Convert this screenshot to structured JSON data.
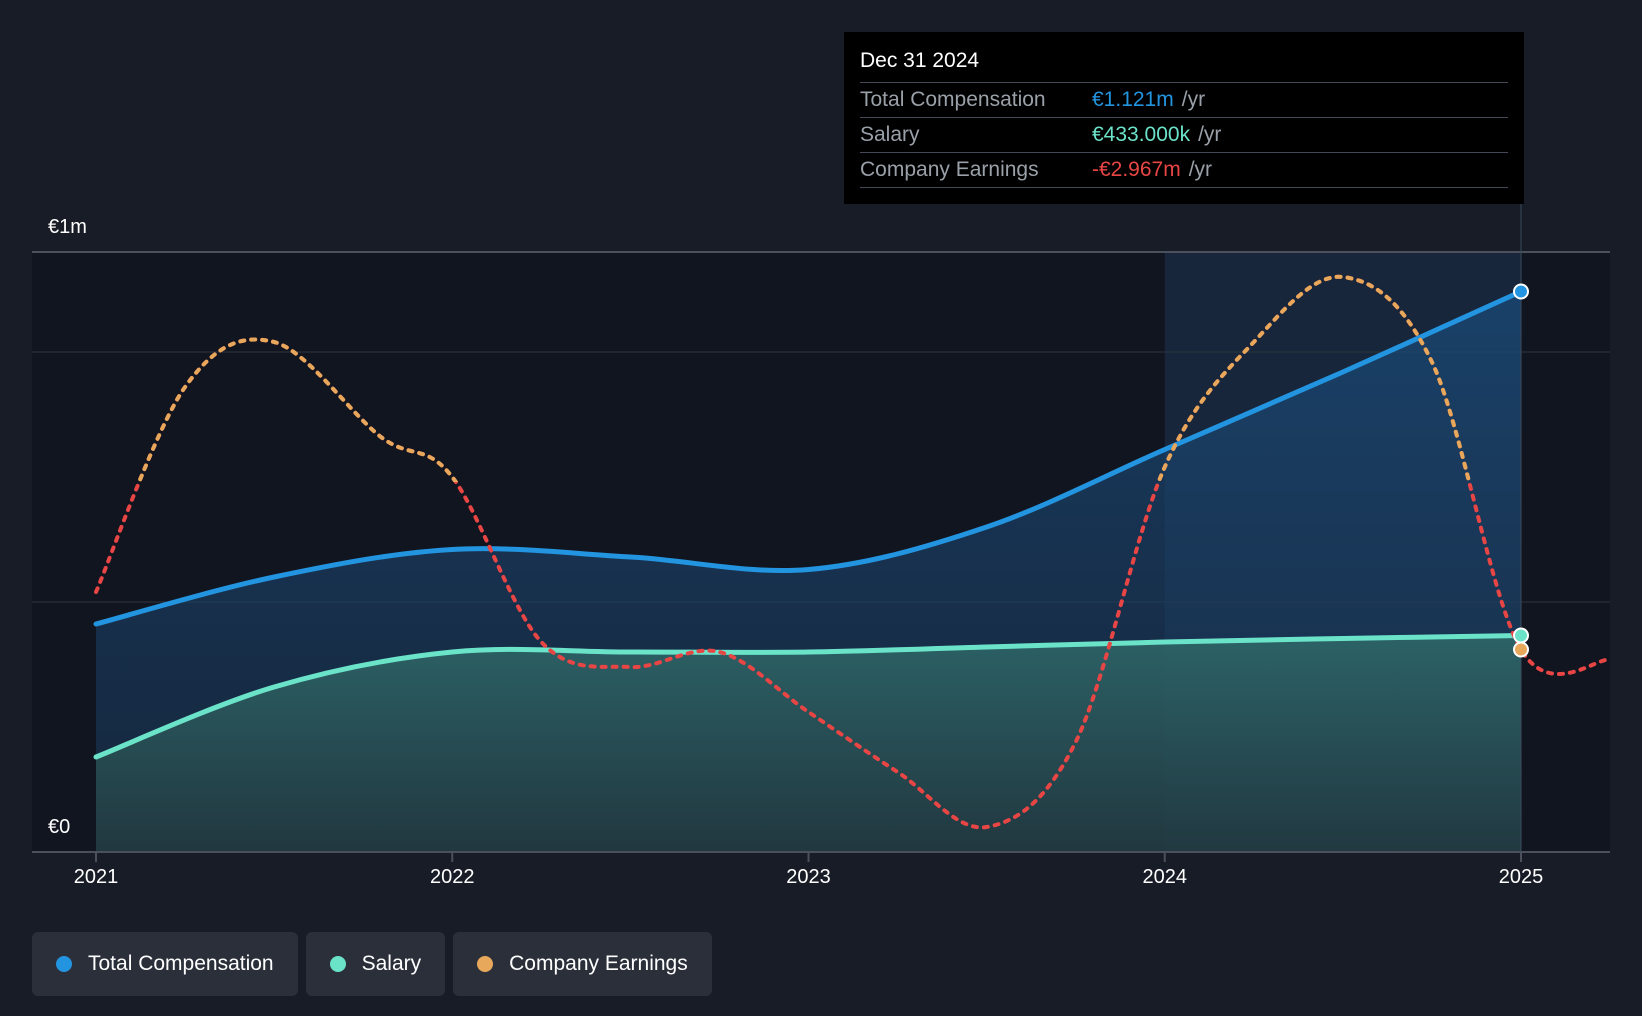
{
  "chart_data": {
    "type": "line",
    "ylabel_top": "€1m",
    "ylabel_bottom": "€0",
    "ylim": [
      0,
      1.2
    ],
    "xlim": [
      2021.0,
      2025.25
    ],
    "x_ticks": [
      "2021",
      "2022",
      "2023",
      "2024",
      "2025"
    ],
    "series": [
      {
        "name": "Total Compensation",
        "color": "#2394df",
        "points": [
          [
            2021.0,
            0.456
          ],
          [
            2021.5,
            0.55
          ],
          [
            2022.0,
            0.605
          ],
          [
            2022.5,
            0.59
          ],
          [
            2023.0,
            0.565
          ],
          [
            2023.5,
            0.65
          ],
          [
            2024.0,
            0.805
          ],
          [
            2024.5,
            0.96
          ],
          [
            2025.0,
            1.121
          ]
        ]
      },
      {
        "name": "Salary",
        "color": "#6be3c9",
        "points": [
          [
            2021.0,
            0.19
          ],
          [
            2021.5,
            0.33
          ],
          [
            2022.0,
            0.4
          ],
          [
            2022.5,
            0.4
          ],
          [
            2023.0,
            0.4
          ],
          [
            2023.5,
            0.41
          ],
          [
            2024.0,
            0.42
          ],
          [
            2024.5,
            0.427
          ],
          [
            2025.0,
            0.433
          ]
        ]
      },
      {
        "name": "Company Earnings",
        "color": "#e8a85c",
        "negative_color": "#e84545",
        "points": [
          [
            2021.0,
            0.52
          ],
          [
            2021.25,
            0.93
          ],
          [
            2021.5,
            1.02
          ],
          [
            2021.8,
            0.83
          ],
          [
            2022.0,
            0.75
          ],
          [
            2022.25,
            0.42
          ],
          [
            2022.5,
            0.37
          ],
          [
            2022.75,
            0.4
          ],
          [
            2023.0,
            0.28
          ],
          [
            2023.25,
            0.16
          ],
          [
            2023.5,
            0.05
          ],
          [
            2023.75,
            0.22
          ],
          [
            2024.0,
            0.77
          ],
          [
            2024.25,
            1.02
          ],
          [
            2024.5,
            1.15
          ],
          [
            2024.75,
            0.98
          ],
          [
            2025.0,
            0.405
          ],
          [
            2025.25,
            0.385
          ]
        ]
      }
    ],
    "highlight_x": [
      2024.0,
      2025.0
    ],
    "tooltip": {
      "date": "Dec 31 2024",
      "rows": [
        {
          "label": "Total Compensation",
          "value": "€1.121m",
          "unit": "/yr",
          "color": "#2394df"
        },
        {
          "label": "Salary",
          "value": "€433.000k",
          "unit": "/yr",
          "color": "#6be3c9"
        },
        {
          "label": "Company Earnings",
          "value": "-€2.967m",
          "unit": "/yr",
          "color": "#e84545"
        }
      ]
    },
    "legend": [
      {
        "label": "Total Compensation",
        "color": "#2394df"
      },
      {
        "label": "Salary",
        "color": "#6be3c9"
      },
      {
        "label": "Company Earnings",
        "color": "#e8a85c"
      }
    ]
  }
}
